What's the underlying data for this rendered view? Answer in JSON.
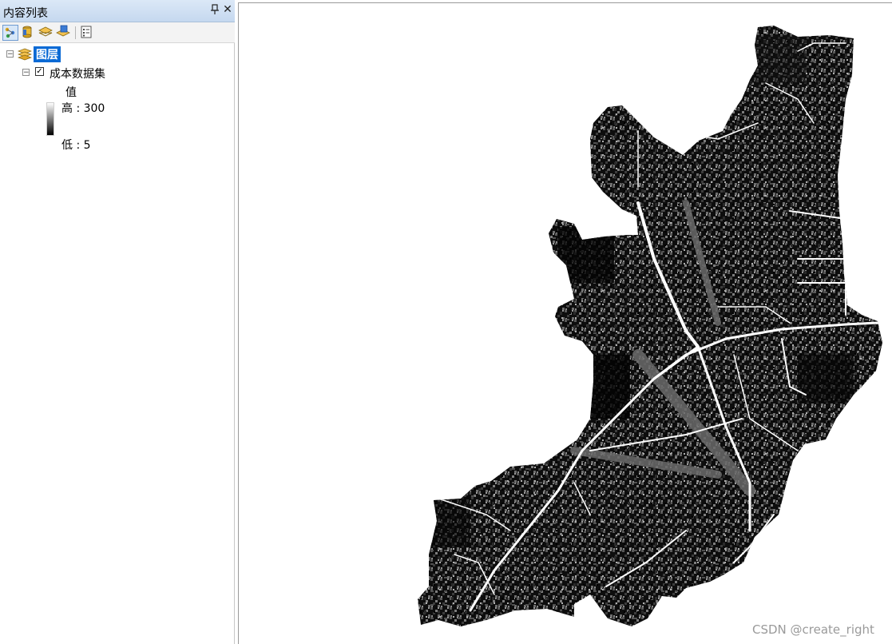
{
  "toc": {
    "title": "内容列表",
    "pin_glyph": "ᵖ",
    "close_glyph": "✕",
    "toolbar": {
      "buttons": [
        {
          "icon": "list-by-drawing-order-icon",
          "active": true
        },
        {
          "icon": "list-by-source-icon",
          "active": false
        },
        {
          "icon": "list-by-visibility-icon",
          "active": false
        },
        {
          "icon": "list-by-selection-icon",
          "active": false
        },
        {
          "icon": "options-icon",
          "active": false
        }
      ]
    },
    "tree": {
      "root_label": "图层",
      "root_expander": "−",
      "layer": {
        "label": "成本数据集",
        "expander": "−",
        "checked": true,
        "check_glyph": "✓",
        "legend": {
          "field": "值",
          "high_label": "高 : 300",
          "low_label": "低 : 5",
          "ramp_top_color": "#ffffff",
          "ramp_bottom_color": "#000000"
        }
      }
    }
  },
  "map": {
    "background": "#ffffff",
    "raster": {
      "description_colors": [
        "#000000",
        "#4a4a4a",
        "#7a7a7a",
        "#ffffff"
      ]
    }
  },
  "watermark": "CSDN @create_right"
}
